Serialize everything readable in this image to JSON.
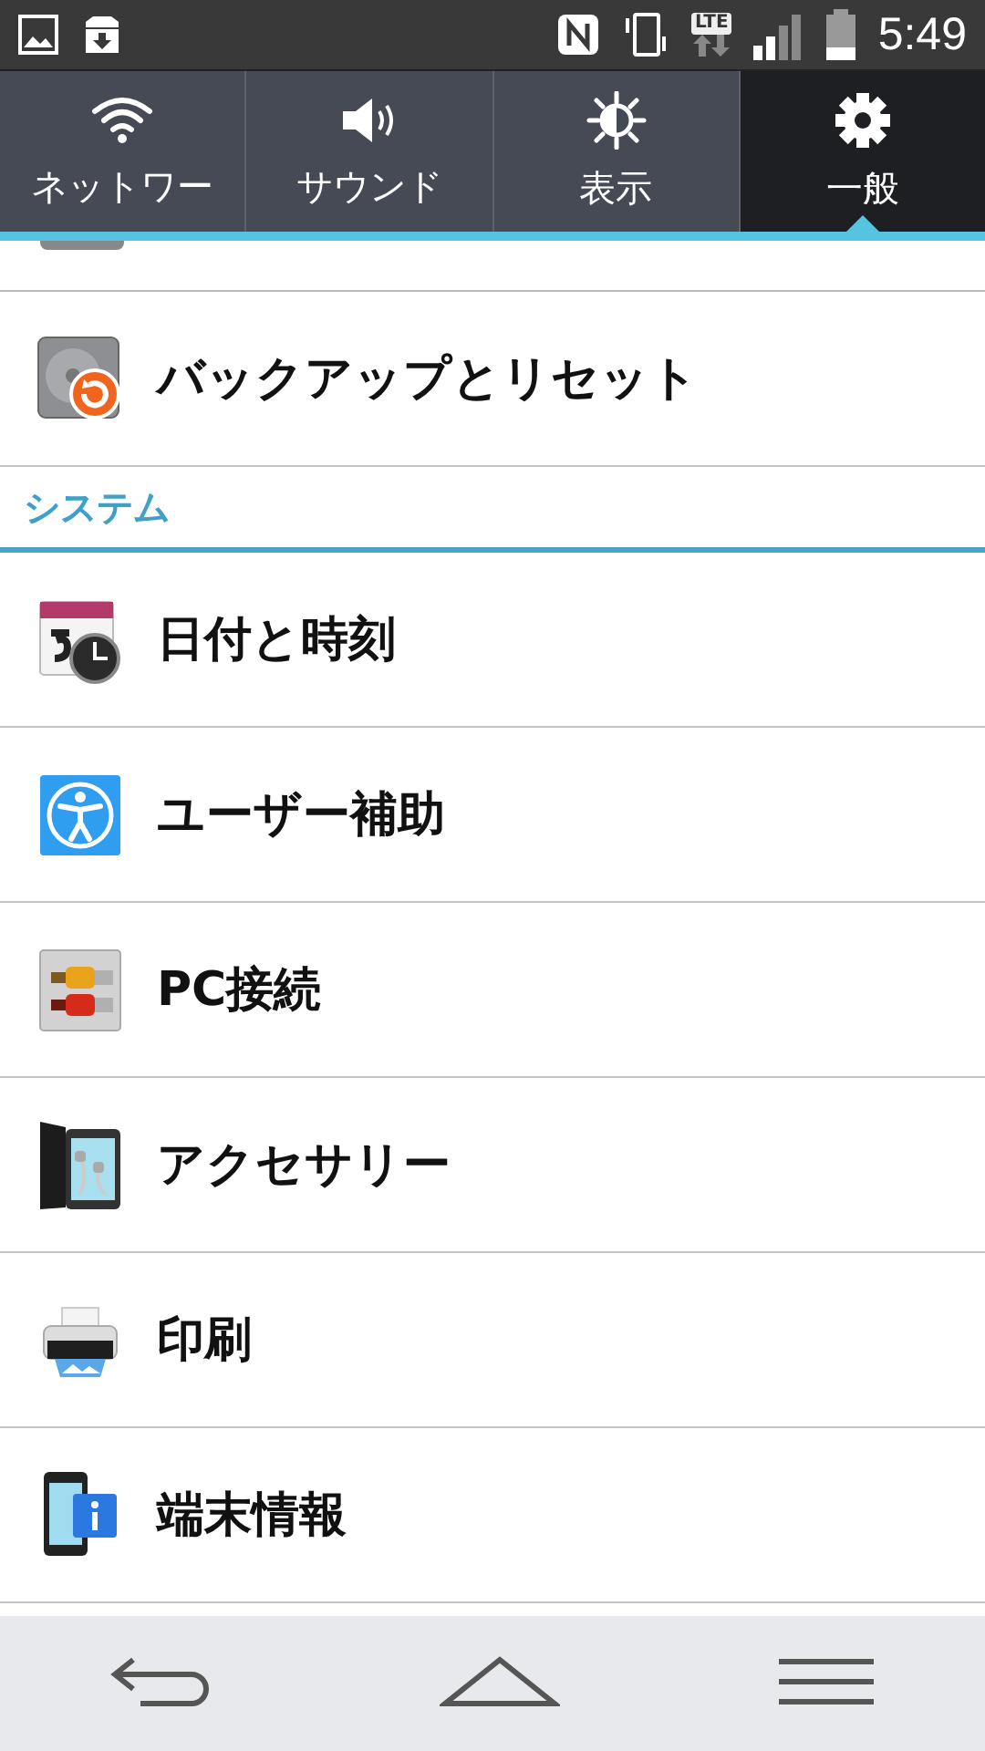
{
  "status_bar": {
    "network_type": "LTE",
    "time": "5:49"
  },
  "tabs": [
    {
      "label": "ネットワー",
      "selected": false
    },
    {
      "label": "サウンド",
      "selected": false
    },
    {
      "label": "表示",
      "selected": false
    },
    {
      "label": "一般",
      "selected": true
    }
  ],
  "sections": [
    {
      "items": [
        {
          "label": "バックアップとリセット"
        }
      ]
    },
    {
      "header": "システム",
      "items": [
        {
          "label": "日付と時刻"
        },
        {
          "label": "ユーザー補助"
        },
        {
          "label": "PC接続"
        },
        {
          "label": "アクセサリー"
        },
        {
          "label": "印刷"
        },
        {
          "label": "端末情報"
        }
      ]
    }
  ]
}
